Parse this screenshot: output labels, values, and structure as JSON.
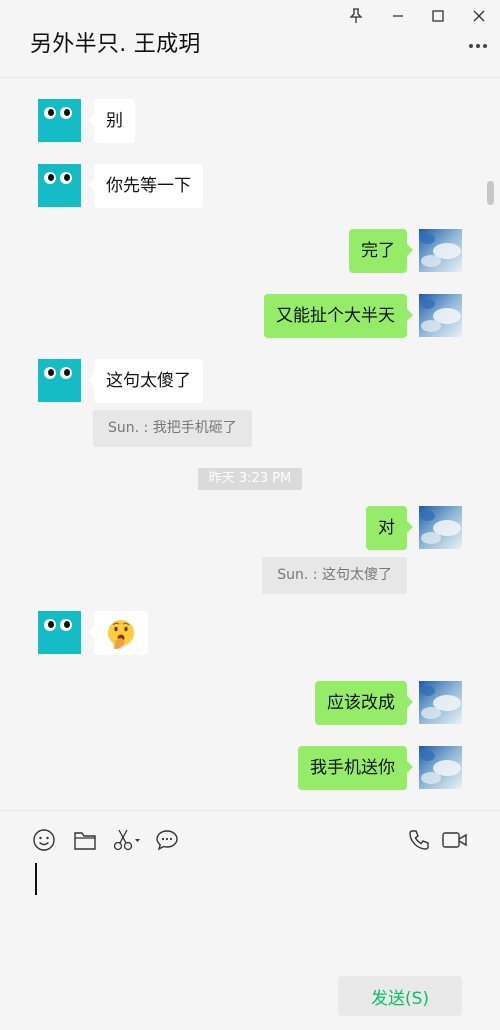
{
  "window": {
    "title": "另外半只. 王成玥"
  },
  "messages": {
    "m1": "别",
    "m2": "你先等一下",
    "m3": "完了",
    "m4": "又能扯个大半天",
    "m5": "这句太傻了",
    "q1": "Sun. : 我把手机砸了",
    "ts1": "昨天 3:23 PM",
    "m6": "对",
    "q2": "Sun. : 这句太傻了",
    "m7": "🫢",
    "m8": "应该改成",
    "m9": "我手机送你"
  },
  "composer": {
    "send_label": "发送(S)",
    "input_value": ""
  },
  "colors": {
    "accent_green": "#95ec69",
    "send_text": "#07c160",
    "friend_avatar": "#14bcc6"
  }
}
